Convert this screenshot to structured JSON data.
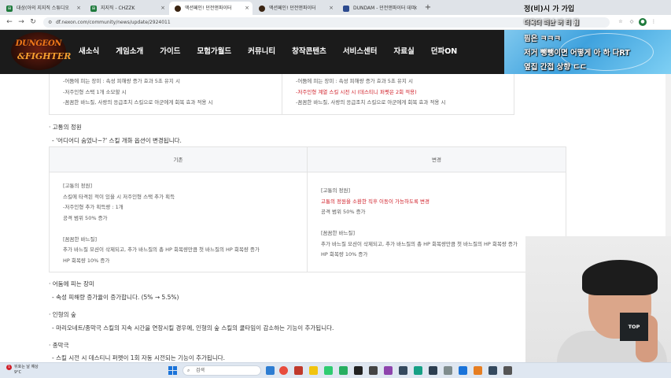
{
  "browser": {
    "tabs": [
      {
        "label": "대상(아의 지지직 스튜디오"
      },
      {
        "label": "지지직 - CHZZK"
      },
      {
        "label": "액션페인! 던전앤파이터"
      },
      {
        "label": "액션페인! 던전앤파이터"
      },
      {
        "label": "DUNDAM - 던전앤파이터 데미"
      }
    ],
    "new_tab": "+",
    "url": "df.nexon.com/community/news/update/2924011",
    "nav": {
      "back": "←",
      "forward": "→",
      "reload": "↻"
    }
  },
  "site": {
    "logo_line1": "DUNGEON",
    "logo_line2": "&FIGHTER",
    "nav_items": [
      "새소식",
      "게임소개",
      "가이드",
      "모험가월드",
      "커뮤니티",
      "창작콘텐츠",
      "서비스센터",
      "자료실",
      "던파ON"
    ]
  },
  "overlay": {
    "lines": [
      "정(비)시 가 가입",
      "더욱더 떠난 버 티 됨",
      "핌은 ㅋㅋㅋ",
      "저거 뺑뺑이면 어떻게 아 하 다RT",
      "옆집 간접 상향 ㄷㄷ"
    ]
  },
  "content": {
    "prev_left": [
      "-어둠에 피는 장미 : 속성 피해량 증가 효과 5초 유지 시",
      "-저주인형 스택 1개 소모할 시",
      "-꼼꼼한 바느질, 사랑의 응급조치 스킬으로 아군에게 회복 효과 적용 시"
    ],
    "prev_right": [
      "-어둠에 피는 장미 : 속성 피해량 증가 효과 5초 유지 시",
      "-저주인형 계열 스킬 시전 시 (데스티니 퍼펫은 2회 적용)",
      "-꼼꼼한 바느질, 사랑의 응급조치 스킬으로 아군에게 회복 효과 적용 시"
    ],
    "sections": [
      {
        "title": "고통의 정원",
        "desc": "- '어디어디 숨었나~?' 스킬 개화 옵션이 변경됩니다."
      },
      {
        "title": "어둠에 피는 장미",
        "desc": "- 속성 피해량 증가율이 증가합니다. (5% → 5.5%)"
      },
      {
        "title": "인형의 숲",
        "desc": "- 마리오네트/종막극 스킬의 지속 시간을 연장시킬 경우에, 인형의 숲 스킬의 쿨타임이 감소하는 기능이 추가됩니다."
      },
      {
        "title": "종막극",
        "desc": "- 스킬 시전 시 데스티니 퍼펫이 1회 자동 시전되는 기능이 추가됩니다."
      }
    ],
    "table": {
      "header_before": "기존",
      "header_after": "변경",
      "before": [
        "[고통의 정원]",
        "스킬에 타격된 적이 있을 시 저주인형 스택 추가 획득",
        "-저주인형 추가 획득량 : 1개",
        "공격 범위 50% 증가",
        "",
        "[꼼꼼한 바느질]",
        "추가 바느질 모션이 삭제되고, 추가 바느질의 총 HP 회복량만큼 첫 바느질의 HP 회복량 증가",
        "HP 회복량 10% 증가"
      ],
      "after": [
        "[고통의 정원]",
        "고통의 정원을 소환한 직후 이동이 가능하도록 변경",
        "공격 범위 50% 증가",
        "",
        "[꼼꼼한 바느질]",
        "추가 바느질 모션이 삭제되고, 추가 바느질의 총 HP 회복량만큼 첫 바느질의 HP 회복량 증가",
        "HP 회복량 10% 증가"
      ]
    }
  },
  "top_button": "TOP",
  "taskbar": {
    "weather_line1": "뒤호는 날 예상",
    "weather_line2": "9°C",
    "notification_count": "1",
    "search_placeholder": "검색"
  },
  "colors": {
    "header_bg": "#1b1b1b",
    "highlight_red": "#d0202a",
    "accent_blue": "#1a73d9"
  }
}
